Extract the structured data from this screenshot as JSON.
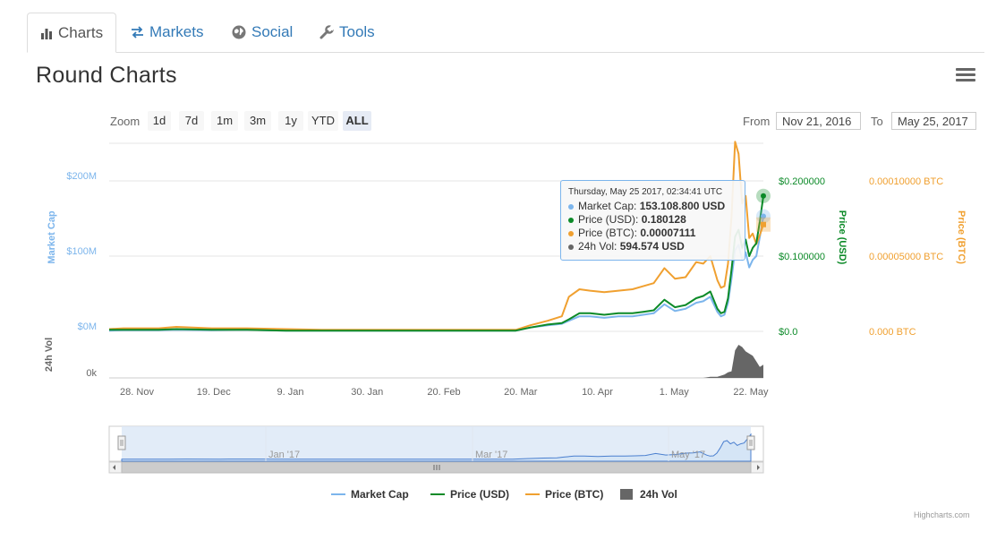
{
  "tabs": [
    {
      "label": "Charts",
      "icon": "bar-chart-icon",
      "active": true
    },
    {
      "label": "Markets",
      "icon": "exchange-arrows-icon",
      "active": false
    },
    {
      "label": "Social",
      "icon": "globe-icon",
      "active": false
    },
    {
      "label": "Tools",
      "icon": "wrench-icon",
      "active": false
    }
  ],
  "page_title": "Round Charts",
  "range_selector": {
    "zoom_label": "Zoom",
    "buttons": [
      "1d",
      "7d",
      "1m",
      "3m",
      "1y",
      "YTD",
      "ALL"
    ],
    "selected": "ALL",
    "from_label": "From",
    "from_value": "Nov 21, 2016",
    "to_label": "To",
    "to_value": "May 25, 2017"
  },
  "tooltip": {
    "header": "Thursday, May 25 2017, 02:34:41 UTC",
    "rows": [
      {
        "label": "Market Cap:",
        "value": "153.108.800 USD",
        "color": "#7cb5ec"
      },
      {
        "label": "Price (USD):",
        "value": "0.180128",
        "color": "#0c8a28"
      },
      {
        "label": "Price (BTC):",
        "value": "0.00007111",
        "color": "#f0a030"
      },
      {
        "label": "24h Vol:",
        "value": "594.574 USD",
        "color": "#666666"
      }
    ]
  },
  "colors": {
    "market_cap": "#7cb5ec",
    "price_usd": "#0c8a28",
    "price_btc": "#f0a030",
    "volume": "#666666",
    "grid": "#e6e6e6",
    "navigator_fill": "#dbe7f6"
  },
  "legend": [
    "Market Cap",
    "Price (USD)",
    "Price (BTC)",
    "24h Vol"
  ],
  "credits": "Highcharts.com",
  "navigator": {
    "labels": [
      "Jan '17",
      "Mar '17",
      "May '17"
    ]
  },
  "chart_data": {
    "type": "line",
    "x_tick_labels": [
      "28. Nov",
      "19. Dec",
      "9. Jan",
      "30. Jan",
      "20. Feb",
      "20. Mar",
      "10. Apr",
      "1. May",
      "22. May"
    ],
    "axes": {
      "market_cap": {
        "title": "Market Cap",
        "ticks": [
          "$0M",
          "$100M",
          "$200M"
        ],
        "range": [
          0,
          250
        ]
      },
      "price_usd": {
        "title": "Price (USD)",
        "ticks": [
          "$0.0",
          "$0.100000",
          "$0.200000"
        ],
        "range": [
          0,
          0.25
        ]
      },
      "price_btc": {
        "title": "Price (BTC)",
        "ticks": [
          "0.000 BTC",
          "0.00005000 BTC",
          "0.00010000 BTC"
        ],
        "range": [
          0,
          0.000125
        ]
      },
      "volume": {
        "title": "24h Vol",
        "ticks": [
          "0k"
        ]
      }
    },
    "x": [
      "2016-11-21",
      "2016-11-25",
      "2016-12-05",
      "2016-12-10",
      "2016-12-20",
      "2016-12-30",
      "2017-01-10",
      "2017-01-20",
      "2017-02-01",
      "2017-02-10",
      "2017-02-20",
      "2017-03-01",
      "2017-03-10",
      "2017-03-16",
      "2017-03-20",
      "2017-03-25",
      "2017-03-29",
      "2017-03-31",
      "2017-04-03",
      "2017-04-06",
      "2017-04-10",
      "2017-04-14",
      "2017-04-18",
      "2017-04-21",
      "2017-04-24",
      "2017-04-27",
      "2017-04-30",
      "2017-05-03",
      "2017-05-06",
      "2017-05-08",
      "2017-05-10",
      "2017-05-12",
      "2017-05-13",
      "2017-05-14",
      "2017-05-15",
      "2017-05-16",
      "2017-05-17",
      "2017-05-18",
      "2017-05-19",
      "2017-05-20",
      "2017-05-21",
      "2017-05-22",
      "2017-05-23",
      "2017-05-24",
      "2017-05-25"
    ],
    "series": [
      {
        "name": "Market Cap",
        "axis": "market_cap",
        "values": [
          1,
          1.5,
          1.5,
          2,
          1.5,
          2,
          1,
          1,
          1,
          1,
          1,
          1,
          1,
          1,
          5,
          8,
          10,
          14,
          20,
          20,
          18,
          20,
          20,
          22,
          24,
          36,
          27,
          30,
          38,
          40,
          46,
          26,
          20,
          22,
          38,
          70,
          108,
          115,
          95,
          105,
          85,
          95,
          100,
          125,
          153
        ]
      },
      {
        "name": "Price (USD)",
        "axis": "price_usd",
        "values": [
          0.002,
          0.002,
          0.002,
          0.003,
          0.002,
          0.002,
          0.001,
          0.001,
          0.001,
          0.001,
          0.001,
          0.001,
          0.001,
          0.001,
          0.005,
          0.009,
          0.011,
          0.016,
          0.024,
          0.024,
          0.022,
          0.024,
          0.024,
          0.026,
          0.028,
          0.042,
          0.032,
          0.035,
          0.044,
          0.047,
          0.053,
          0.03,
          0.024,
          0.026,
          0.044,
          0.082,
          0.126,
          0.135,
          0.111,
          0.122,
          0.1,
          0.111,
          0.117,
          0.146,
          0.18
        ]
      },
      {
        "name": "Price (BTC)",
        "axis": "price_btc",
        "values": [
          1.5e-06,
          2e-06,
          2e-06,
          3e-06,
          2e-06,
          2e-06,
          1.5e-06,
          1e-06,
          1e-06,
          1e-06,
          1e-06,
          1e-06,
          1e-06,
          1e-06,
          4e-06,
          7e-06,
          1e-05,
          2.3e-05,
          2.8e-05,
          2.7e-05,
          2.6e-05,
          2.7e-05,
          2.8e-05,
          3e-05,
          3.2e-05,
          4.2e-05,
          3.5e-05,
          3.6e-05,
          4.6e-05,
          4.5e-05,
          5e-05,
          3.4e-05,
          2.9e-05,
          3e-05,
          4.5e-05,
          7.6e-05,
          0.000126,
          0.000118,
          8.5e-05,
          9e-05,
          6.2e-05,
          6.5e-05,
          5.8e-05,
          6.4e-05,
          7.1e-05
        ]
      },
      {
        "name": "24h Vol",
        "axis": "volume",
        "type": "area",
        "values": [
          0,
          0,
          0,
          0,
          0,
          0,
          0,
          0,
          0,
          0,
          0,
          0,
          0,
          0,
          0,
          0,
          0,
          0,
          0,
          0,
          0,
          0,
          0,
          0,
          0,
          0,
          0,
          0,
          0,
          0,
          1,
          1,
          2,
          3,
          5,
          6,
          25,
          30,
          28,
          24,
          22,
          20,
          15,
          10,
          12
        ]
      }
    ]
  }
}
